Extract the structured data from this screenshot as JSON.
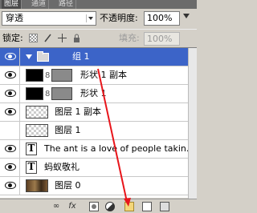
{
  "tabs": [
    {
      "label": "图层",
      "active": true
    },
    {
      "label": "通道",
      "active": false
    },
    {
      "label": "路径",
      "active": false
    }
  ],
  "blend_mode": {
    "value": "穿透"
  },
  "opacity": {
    "label": "不透明度:",
    "value": "100%"
  },
  "lock": {
    "label": "锁定:"
  },
  "fill": {
    "label": "填充:",
    "value": "100%"
  },
  "layers": [
    {
      "name": "组 1",
      "kind": "group",
      "visible": true,
      "selected": true
    },
    {
      "name": "形状 1 副本",
      "kind": "shape",
      "visible": true,
      "selected": false
    },
    {
      "name": "形状 1",
      "kind": "shape",
      "visible": true,
      "selected": false
    },
    {
      "name": "图层 1 副本",
      "kind": "raster",
      "visible": true,
      "selected": false
    },
    {
      "name": "图层 1",
      "kind": "raster",
      "visible": false,
      "selected": false
    },
    {
      "name": "The ant is a love of people takin...",
      "kind": "text",
      "visible": true,
      "selected": false
    },
    {
      "name": "蚂蚁敬礼",
      "kind": "text",
      "visible": true,
      "selected": false
    },
    {
      "name": "图层 0",
      "kind": "photo",
      "visible": true,
      "selected": false
    }
  ],
  "text_thumb_glyph": "T",
  "chain_glyph": "8",
  "bottom_bar": {
    "icons": [
      "link-icon",
      "fx-icon",
      "mask-icon",
      "adjustment-icon",
      "new-group-icon",
      "new-layer-icon",
      "delete-icon"
    ],
    "fx_label": "fx",
    "link_label": "∞"
  },
  "colors": {
    "selection": "#3c64c8",
    "annotation_arrow": "#e8151b"
  }
}
